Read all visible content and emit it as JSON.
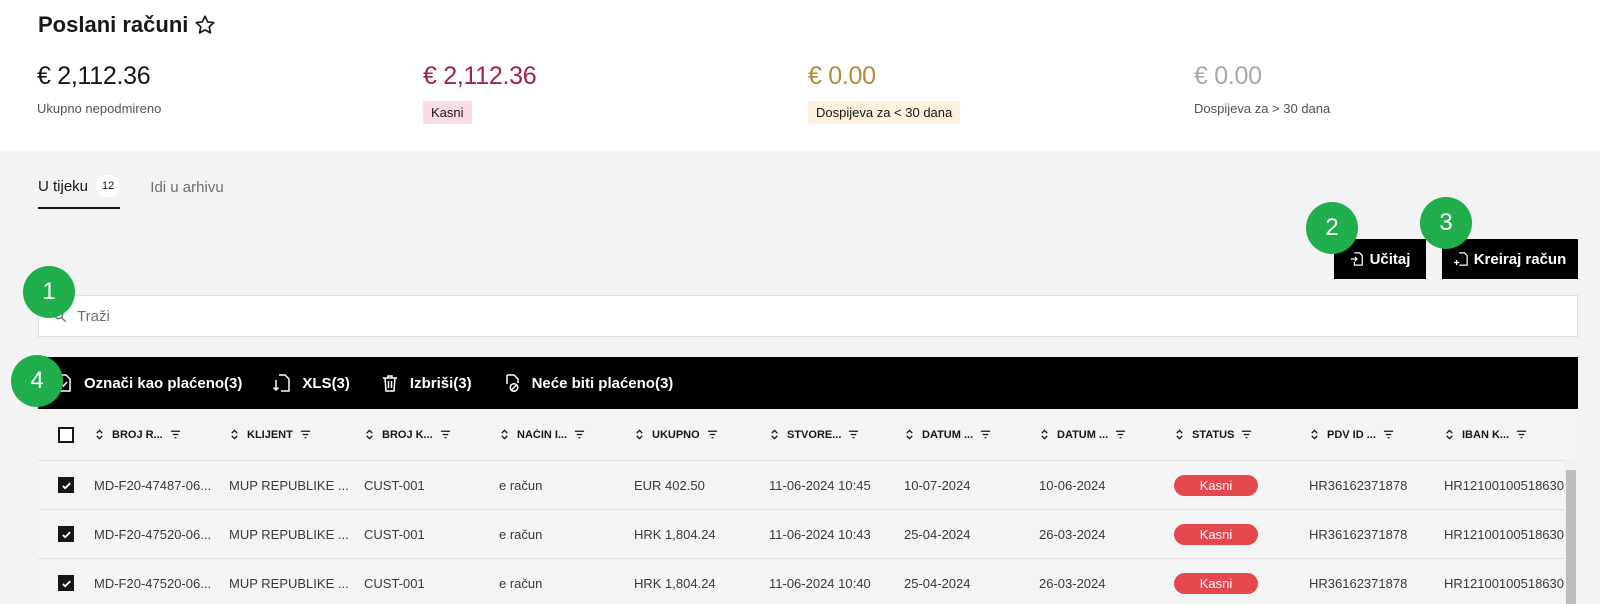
{
  "page": {
    "title": "Poslani računi"
  },
  "kpis": [
    {
      "amount": "€ 2,112.36",
      "label": "Ukupno nepodmireno",
      "color": "#161616",
      "tag_bg": ""
    },
    {
      "amount": "€ 2,112.36",
      "label": "Kasni",
      "color": "#a2234a",
      "tag_bg": "#fbdde1"
    },
    {
      "amount": "€ 0.00",
      "label": "Dospijeva za < 30 dana",
      "color": "#b58a3a",
      "tag_bg": "#fcf0de"
    },
    {
      "amount": "€ 0.00",
      "label": "Dospijeva za > 30 dana",
      "color": "#a8a8a8",
      "tag_bg": ""
    }
  ],
  "tabs": [
    {
      "label": "U tijeku",
      "count": "12"
    },
    {
      "label": "Idi u arhivu"
    }
  ],
  "buttons": {
    "load": "Učitaj",
    "create": "Kreiraj račun"
  },
  "search": {
    "placeholder": "Traži"
  },
  "bulk_actions": [
    {
      "label": "Označi kao plaćeno(3)"
    },
    {
      "label": "XLS(3)"
    },
    {
      "label": "Izbriši(3)"
    },
    {
      "label": "Neće biti plaćeno(3)"
    }
  ],
  "table": {
    "columns": [
      "BROJ R...",
      "KLIJENT",
      "BROJ K...",
      "NAČIN I...",
      "UKUPNO",
      "STVORE...",
      "DATUM ...",
      "DATUM ...",
      "STATUS",
      "PDV ID ...",
      "IBAN K..."
    ],
    "rows": [
      [
        "MD-F20-47487-06...",
        "MUP REPUBLIKE ...",
        "CUST-001",
        "e račun",
        "EUR 402.50",
        "11-06-2024 10:45",
        "10-07-2024",
        "10-06-2024",
        "Kasni",
        "HR36162371878",
        "HR12100100518630"
      ],
      [
        "MD-F20-47520-06...",
        "MUP REPUBLIKE ...",
        "CUST-001",
        "e račun",
        "HRK 1,804.24",
        "11-06-2024 10:43",
        "25-04-2024",
        "26-03-2024",
        "Kasni",
        "HR36162371878",
        "HR12100100518630"
      ],
      [
        "MD-F20-47520-06...",
        "MUP REPUBLIKE ...",
        "CUST-001",
        "e račun",
        "HRK 1,804.24",
        "11-06-2024 10:40",
        "25-04-2024",
        "26-03-2024",
        "Kasni",
        "HR36162371878",
        "HR12100100518630"
      ]
    ]
  },
  "markers": [
    "1",
    "2",
    "3",
    "4"
  ],
  "colors": {
    "accent_green": "#1fae4b",
    "danger": "#e5474f",
    "black": "#000000"
  }
}
